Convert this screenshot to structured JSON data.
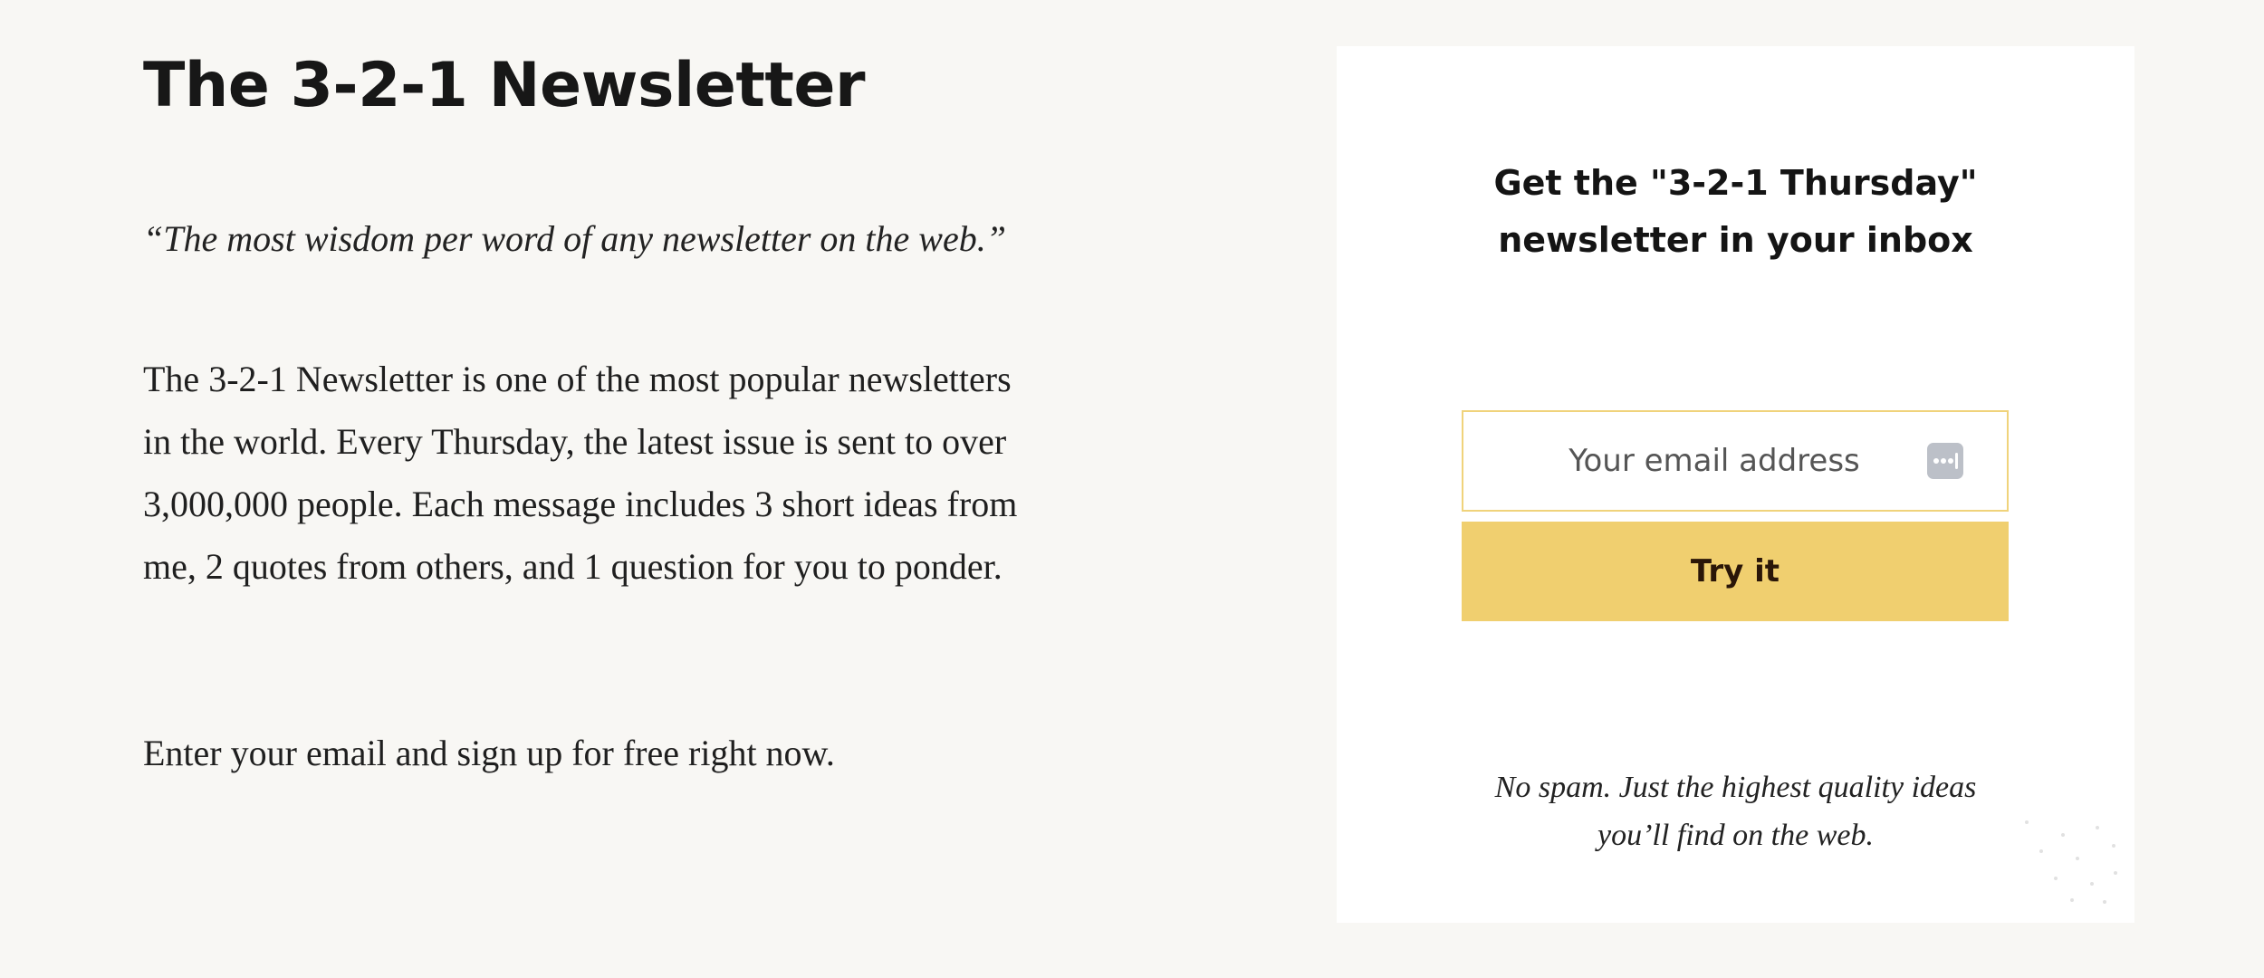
{
  "left": {
    "title": "The 3-2-1 Newsletter",
    "quote": "“The most wisdom per word of any newsletter on the web.”",
    "description": "The 3-2-1 Newsletter is one of the most popular newsletters in the world. Every Thursday, the latest issue is sent to over 3,000,000 people. Each message includes 3 short ideas from me, 2 quotes from others, and 1 question for you to ponder.",
    "signup_text": "Enter your email and sign up for free right now."
  },
  "card": {
    "heading_line1": "Get the \"3-2-1 Thursday\"",
    "heading_line2": "newsletter in your inbox",
    "email_placeholder": "Your email address",
    "email_value": "",
    "button_label": "Try it",
    "footnote_line1": "No spam. Just the highest quality ideas",
    "footnote_line2": "you’ll find on the web.",
    "input_icon": "password-manager-icon",
    "accent_color": "#f0cf6f",
    "input_border_color": "#f0d37b"
  }
}
